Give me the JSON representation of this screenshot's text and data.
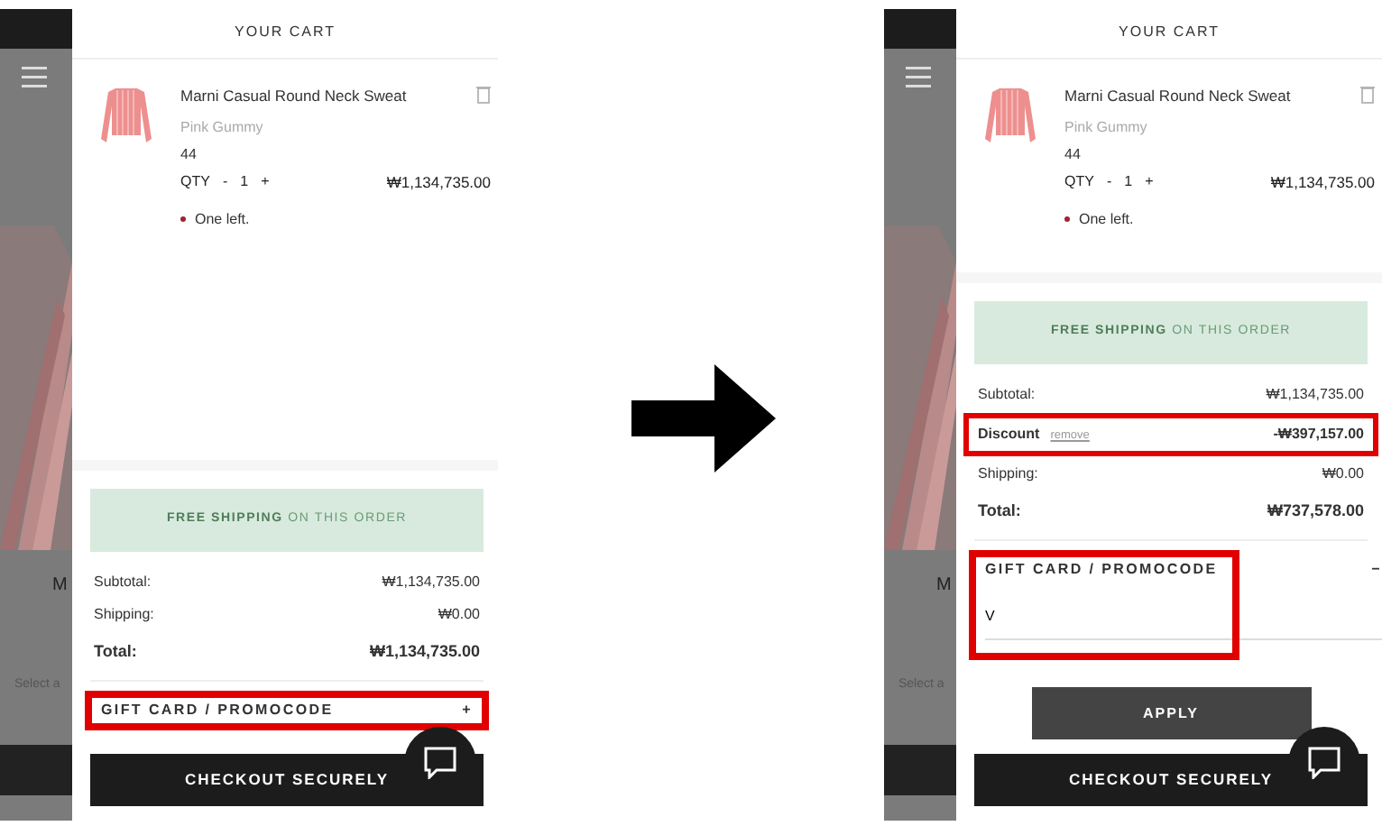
{
  "panels": [
    {
      "background_texts": [
        "M",
        "Select a"
      ],
      "cart_title": "YOUR CART",
      "item": {
        "name": "Marni Casual Round Neck Sweat",
        "variant": "Pink Gummy",
        "size": "44",
        "qty_label": "QTY",
        "qty_minus": "-",
        "qty": "1",
        "qty_plus": "+",
        "price": "₩1,134,735.00",
        "stock_note": "One left."
      },
      "shipping_banner": "**FREE SHIPPING** ON THIS ORDER",
      "summary": [
        {
          "kind": "plain",
          "label": "Subtotal:",
          "value": "₩1,134,735.00",
          "highlighted": false
        },
        {
          "kind": "plain",
          "label": "Shipping:",
          "value": "₩0.00",
          "highlighted": false
        },
        {
          "kind": "total",
          "label": "Total:",
          "value": "₩1,134,735.00",
          "highlighted": false
        }
      ],
      "promo": {
        "label": "GIFT CARD / PROMOCODE",
        "toggle": "+",
        "expanded": false,
        "highlighted": true
      },
      "checkout": "CHECKOUT SECURELY"
    },
    {
      "background_texts": [
        "M",
        "Select a"
      ],
      "cart_title": "YOUR CART",
      "item": {
        "name": "Marni Casual Round Neck Sweat",
        "variant": "Pink Gummy",
        "size": "44",
        "qty_label": "QTY",
        "qty_minus": "-",
        "qty": "1",
        "qty_plus": "+",
        "price": "₩1,134,735.00",
        "stock_note": "One left."
      },
      "shipping_banner": "**FREE SHIPPING** ON THIS ORDER",
      "summary": [
        {
          "kind": "plain",
          "label": "Subtotal:",
          "value": "₩1,134,735.00",
          "highlighted": false
        },
        {
          "kind": "discount",
          "label": "Discount",
          "link": "remove",
          "value": "-₩397,157.00",
          "highlighted": true
        },
        {
          "kind": "plain",
          "label": "Shipping:",
          "value": "₩0.00",
          "highlighted": false
        },
        {
          "kind": "total",
          "label": "Total:",
          "value": "₩737,578.00",
          "highlighted": false
        }
      ],
      "promo": {
        "label": "GIFT CARD / PROMOCODE",
        "toggle": "−",
        "expanded": true,
        "highlighted": true,
        "value": "V",
        "button": "APPLY"
      },
      "checkout": "CHECKOUT SECURELY"
    }
  ]
}
